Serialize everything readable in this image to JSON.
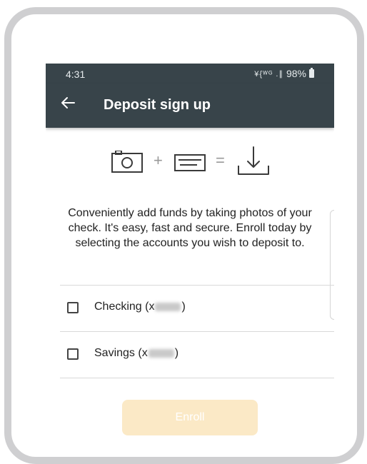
{
  "status_bar": {
    "time": "4:31",
    "signal": "¥{ᵂᴳ .∥",
    "battery": "98%"
  },
  "app_bar": {
    "title": "Deposit sign up",
    "back_icon": "arrow-left-icon"
  },
  "hero_icons": [
    "camera-icon",
    "plus-icon",
    "check-card-icon",
    "equals-icon",
    "download-icon"
  ],
  "hero_symbols": {
    "plus": "+",
    "equals": "="
  },
  "intro_text": "Conveniently add funds by taking photos of your check. It's easy, fast and secure. Enroll today by selecting the accounts you wish to deposit to.",
  "accounts": [
    {
      "prefix": "Checking (x",
      "suffix": ")",
      "checked": false
    },
    {
      "prefix": "Savings (x",
      "suffix": ")",
      "checked": false
    }
  ],
  "enroll_button": {
    "label": "Enroll",
    "enabled": false
  },
  "colors": {
    "header": "#38444a",
    "enroll_disabled": "#fbe9c6",
    "icon_stroke": "#3a3a3a"
  }
}
